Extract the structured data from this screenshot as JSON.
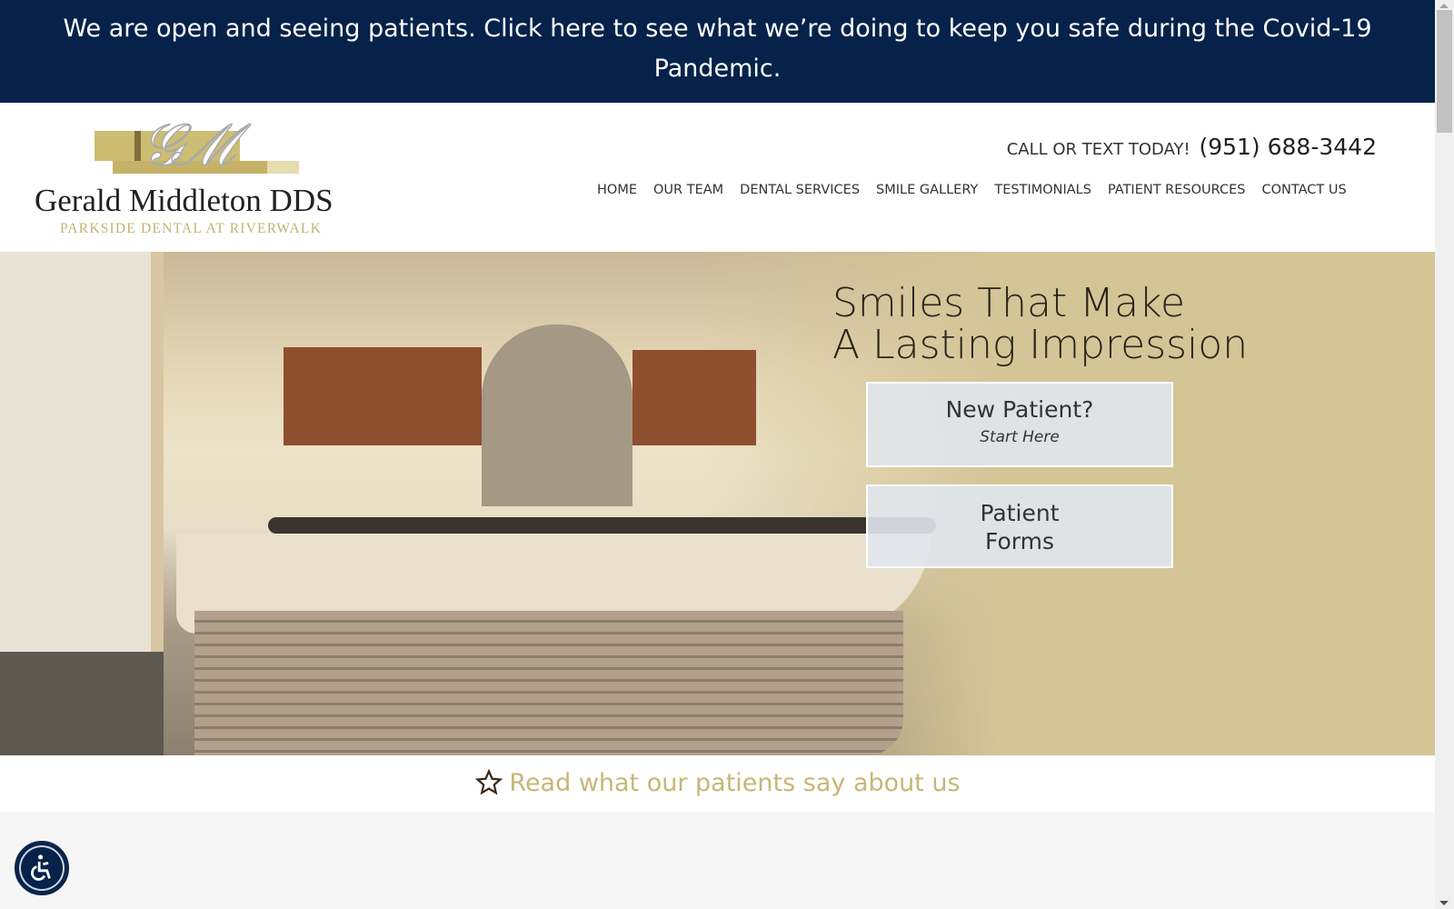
{
  "banner": {
    "text": "We are open and seeing patients. Click here to see what we’re doing to keep you safe during the Covid-19 Pandemic."
  },
  "logo": {
    "monogram": "GM",
    "name": "Gerald Middleton DDS",
    "tagline": "PARKSIDE DENTAL AT RIVERWALK"
  },
  "header": {
    "call_label": "CALL OR TEXT TODAY!",
    "phone": "(951) 688-3442"
  },
  "nav": [
    "HOME",
    "OUR TEAM",
    "DENTAL SERVICES",
    "SMILE GALLERY",
    "TESTIMONIALS",
    "PATIENT RESOURCES",
    "CONTACT US"
  ],
  "hero": {
    "title_line1": "Smiles That Make",
    "title_line2": "A Lasting Impression",
    "new_patient": {
      "title": "New Patient?",
      "subtitle": "Start Here"
    },
    "patient_forms": {
      "line1": "Patient",
      "line2": "Forms"
    }
  },
  "reviews": {
    "text": "Read what our patients say about us",
    "icon": "star-outline-icon"
  },
  "colors": {
    "banner": "#06224a",
    "gold": "#c8b676",
    "hero_bg": "#d4c597"
  },
  "accessibility": {
    "icon": "accessibility-icon"
  }
}
